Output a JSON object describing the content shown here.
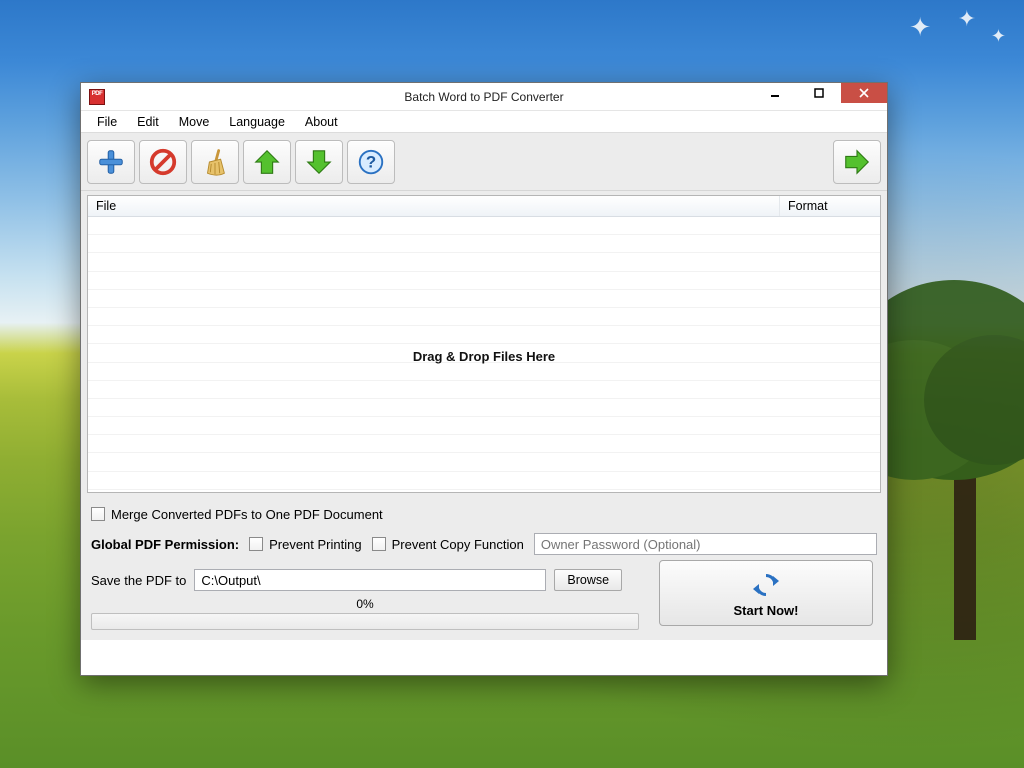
{
  "window": {
    "title": "Batch Word to PDF Converter"
  },
  "menu": {
    "file": "File",
    "edit": "Edit",
    "move": "Move",
    "language": "Language",
    "about": "About"
  },
  "toolbar": {
    "add": "add",
    "remove": "remove",
    "clear": "clear",
    "move_up": "move-up",
    "move_down": "move-down",
    "help": "help",
    "start": "start"
  },
  "list": {
    "col_file": "File",
    "col_format": "Format",
    "drop_hint": "Drag & Drop Files Here"
  },
  "options": {
    "merge_label": "Merge Converted PDFs to One PDF Document",
    "perm_label": "Global PDF Permission:",
    "prevent_printing": "Prevent Printing",
    "prevent_copy": "Prevent Copy Function",
    "owner_pw_placeholder": "Owner Password (Optional)"
  },
  "output": {
    "save_label": "Save the PDF to",
    "path": "C:\\Output\\",
    "browse": "Browse"
  },
  "progress": {
    "text": "0%"
  },
  "start": {
    "label": "Start Now!"
  }
}
